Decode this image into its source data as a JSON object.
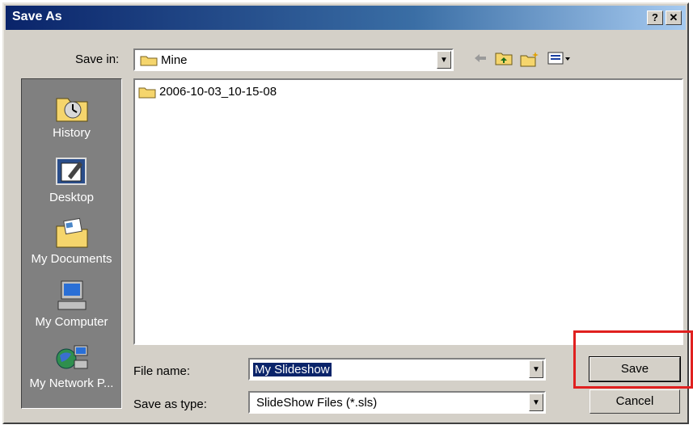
{
  "window": {
    "title": "Save As",
    "help_label": "?",
    "close_label": "✕"
  },
  "toolbar": {
    "save_in_label": "Save in:",
    "save_in_value": "Mine",
    "icons": [
      "back-arrow-icon",
      "up-folder-icon",
      "new-folder-icon",
      "view-menu-icon"
    ]
  },
  "places": [
    {
      "label": "History",
      "icon": "history-icon"
    },
    {
      "label": "Desktop",
      "icon": "desktop-icon"
    },
    {
      "label": "My Documents",
      "icon": "my-documents-icon"
    },
    {
      "label": "My Computer",
      "icon": "my-computer-icon"
    },
    {
      "label": "My Network P...",
      "icon": "my-network-icon"
    }
  ],
  "files": [
    {
      "name": "2006-10-03_10-15-08",
      "icon": "folder-icon"
    }
  ],
  "form": {
    "file_name_label": "File name:",
    "file_name_value": "My Slideshow",
    "save_type_label": "Save as type:",
    "save_type_value": "SlideShow Files (*.sls)"
  },
  "buttons": {
    "save": "Save",
    "cancel": "Cancel"
  },
  "colors": {
    "highlight": "#e0201f",
    "title_bar": "#0a246a"
  }
}
